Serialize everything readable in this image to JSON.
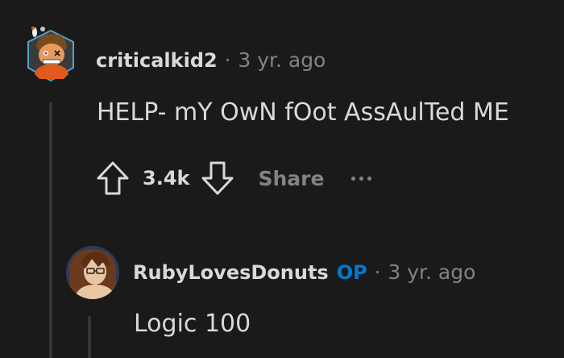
{
  "comments": [
    {
      "username": "criticalkid2",
      "separator": "·",
      "timestamp": "3 yr. ago",
      "body": "HELP- mY OwN fOot AssAulTed ME",
      "votes": "3.4k",
      "share_label": "Share",
      "avatar_icon": "cartoon-avatar-icon",
      "upvote_icon": "arrow-up-icon",
      "downvote_icon": "arrow-down-icon",
      "more_icon": "more-dots-icon"
    },
    {
      "username": "RubyLovesDonuts",
      "op_badge": "OP",
      "separator": "·",
      "timestamp": "3 yr. ago",
      "body": "Logic 100",
      "avatar_icon": "anime-avatar-icon"
    }
  ],
  "colors": {
    "background": "#1a1a1b",
    "text": "#d7dadc",
    "muted": "#818384",
    "op": "#0079d3",
    "thread_line": "#343536"
  }
}
